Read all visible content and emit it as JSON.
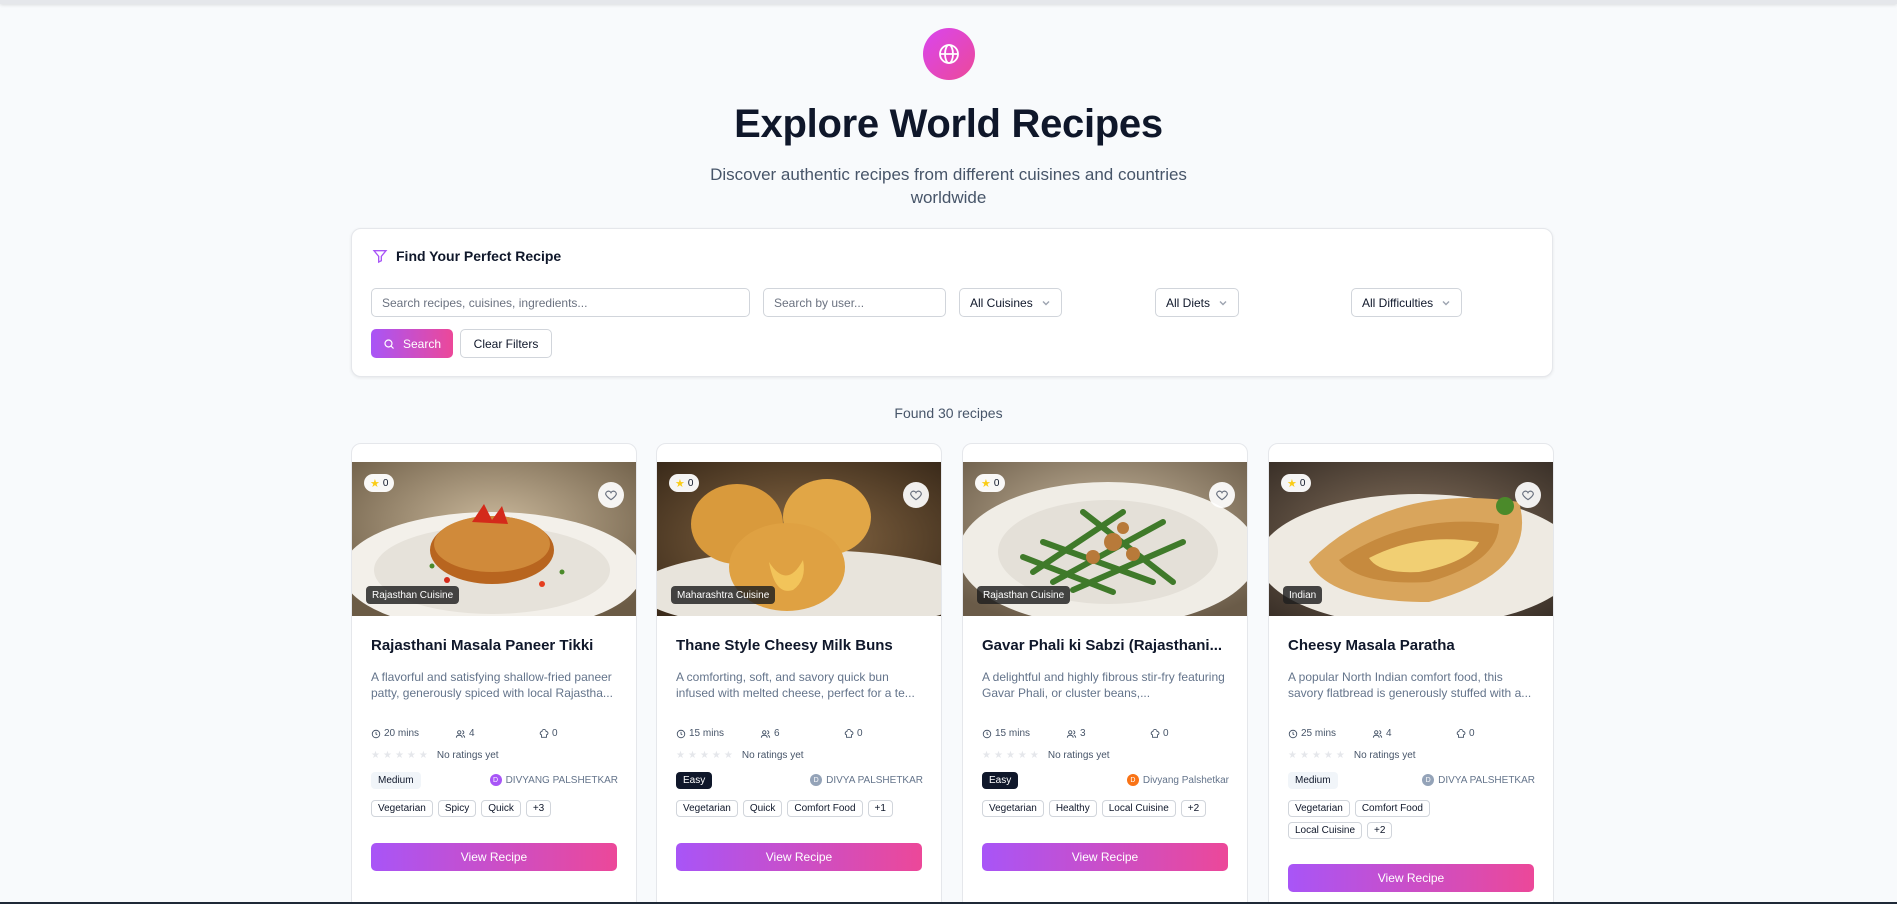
{
  "hero": {
    "title": "Explore World Recipes",
    "subtitle": "Discover authentic recipes from different cuisines and countries worldwide"
  },
  "filters": {
    "title": "Find Your Perfect Recipe",
    "search_placeholder": "Search recipes, cuisines, ingredients...",
    "user_placeholder": "Search by user...",
    "cuisine_select": "All Cuisines",
    "diet_select": "All Diets",
    "difficulty_select": "All Difficulties",
    "search_button": "Search",
    "clear_button": "Clear Filters"
  },
  "results": {
    "found_text": "Found 30 recipes"
  },
  "recipes": [
    {
      "rating": "0",
      "cuisine": "Rajasthan Cuisine",
      "title": "Rajasthani Masala Paneer Tikki",
      "description": "A flavorful and satisfying shallow-fried paneer patty, generously spiced with local Rajastha...",
      "time": "20 mins",
      "servings": "4",
      "likes": "0",
      "ratings_text": "No ratings yet",
      "difficulty": "Medium",
      "author": "DIVYANG PALSHETKAR",
      "author_initial": "D",
      "author_color": "#a855f7",
      "tags": [
        "Vegetarian",
        "Spicy",
        "Quick",
        "+3"
      ],
      "button": "View Recipe"
    },
    {
      "rating": "0",
      "cuisine": "Maharashtra Cuisine",
      "title": "Thane Style Cheesy Milk Buns",
      "description": "A comforting, soft, and savory quick bun infused with melted cheese, perfect for a te...",
      "time": "15 mins",
      "servings": "6",
      "likes": "0",
      "ratings_text": "No ratings yet",
      "difficulty": "Easy",
      "author": "DIVYA PALSHETKAR",
      "author_initial": "D",
      "author_color": "#94a3b8",
      "tags": [
        "Vegetarian",
        "Quick",
        "Comfort Food",
        "+1"
      ],
      "button": "View Recipe"
    },
    {
      "rating": "0",
      "cuisine": "Rajasthan Cuisine",
      "title": "Gavar Phali ki Sabzi (Rajasthani...",
      "description": "A delightful and highly fibrous stir-fry featuring Gavar Phali, or cluster beans,...",
      "time": "15 mins",
      "servings": "3",
      "likes": "0",
      "ratings_text": "No ratings yet",
      "difficulty": "Easy",
      "author": "Divyang Palshetkar",
      "author_initial": "D",
      "author_color": "#f97316",
      "tags": [
        "Vegetarian",
        "Healthy",
        "Local Cuisine",
        "+2"
      ],
      "button": "View Recipe"
    },
    {
      "rating": "0",
      "cuisine": "Indian",
      "title": "Cheesy Masala Paratha",
      "description": "A popular North Indian comfort food, this savory flatbread is generously stuffed with a...",
      "time": "25 mins",
      "servings": "4",
      "likes": "0",
      "ratings_text": "No ratings yet",
      "difficulty": "Medium",
      "author": "DIVYA PALSHETKAR",
      "author_initial": "D",
      "author_color": "#94a3b8",
      "tags": [
        "Vegetarian",
        "Comfort Food",
        "Local Cuisine",
        "+2"
      ],
      "button": "View Recipe"
    }
  ],
  "colors": {
    "accent_gradient_start": "#a855f7",
    "accent_gradient_end": "#ec4899",
    "star_rating": "#facc15"
  }
}
